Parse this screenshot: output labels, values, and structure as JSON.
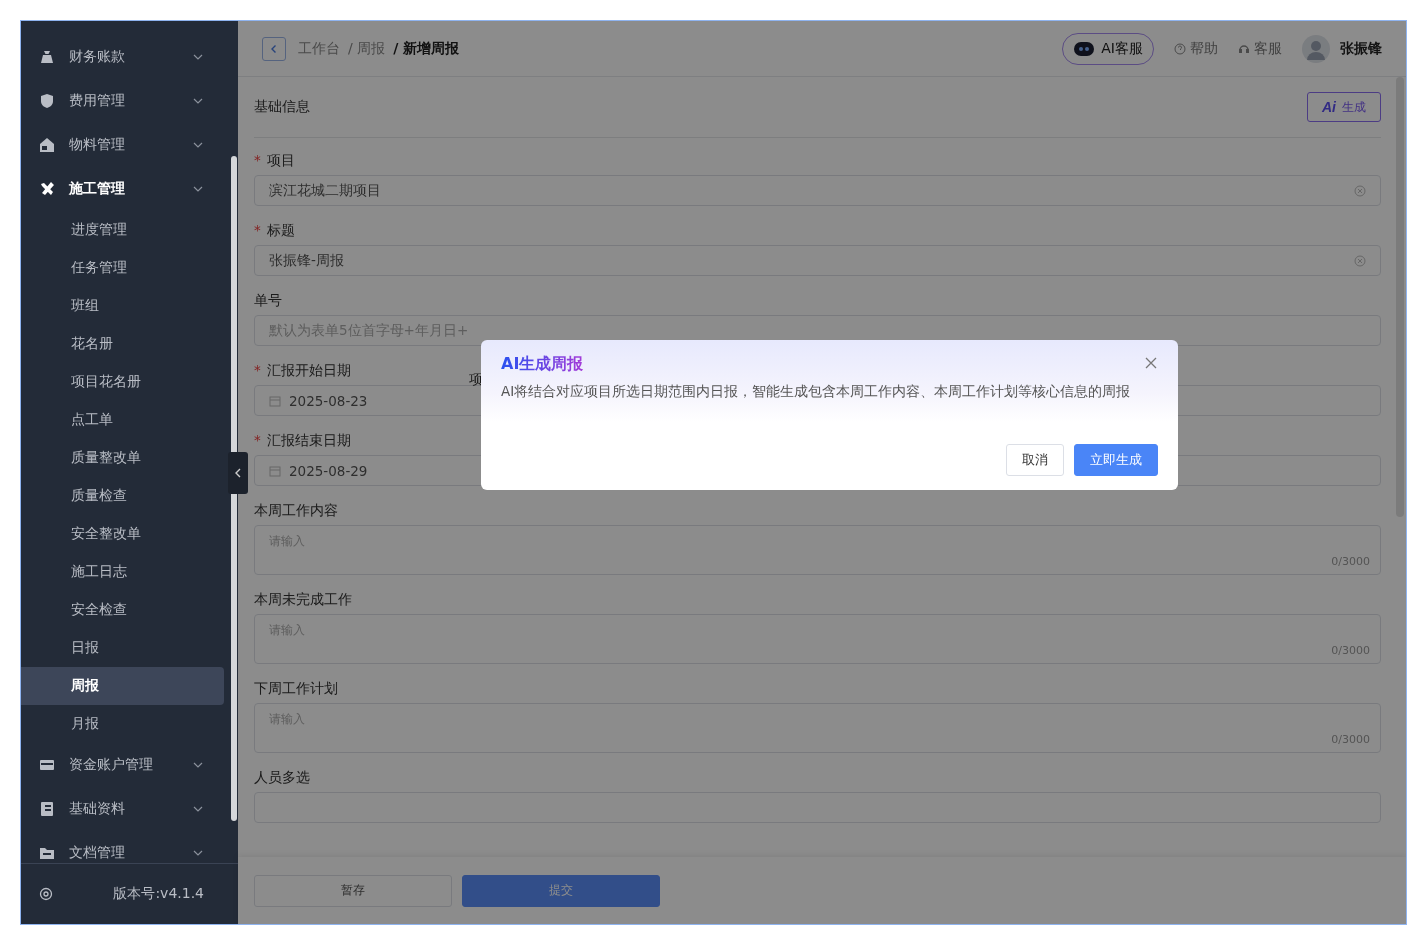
{
  "sidebar": {
    "groups": [
      {
        "label": "财务账款",
        "kind": "money-bag",
        "expanded": false
      },
      {
        "label": "费用管理",
        "kind": "shield",
        "expanded": false
      },
      {
        "label": "物料管理",
        "kind": "house",
        "expanded": false
      },
      {
        "label": "施工管理",
        "kind": "tools",
        "expanded": true,
        "children": [
          {
            "label": "进度管理",
            "selected": false
          },
          {
            "label": "任务管理",
            "selected": false
          },
          {
            "label": "班组",
            "selected": false
          },
          {
            "label": "花名册",
            "selected": false
          },
          {
            "label": "项目花名册",
            "selected": false
          },
          {
            "label": "点工单",
            "selected": false
          },
          {
            "label": "质量整改单",
            "selected": false
          },
          {
            "label": "质量检查",
            "selected": false
          },
          {
            "label": "安全整改单",
            "selected": false
          },
          {
            "label": "施工日志",
            "selected": false
          },
          {
            "label": "安全检查",
            "selected": false
          },
          {
            "label": "日报",
            "selected": false
          },
          {
            "label": "周报",
            "selected": true
          },
          {
            "label": "月报",
            "selected": false
          }
        ]
      },
      {
        "label": "资金账户管理",
        "kind": "card",
        "expanded": false
      },
      {
        "label": "基础资料",
        "kind": "book",
        "expanded": false
      },
      {
        "label": "文档管理",
        "kind": "folder",
        "expanded": false
      }
    ],
    "version": "版本号:v4.1.4"
  },
  "header": {
    "breadcrumb": [
      "工作台",
      "/ 周报",
      "/ 新增周报"
    ],
    "ai_service": "AI客服",
    "help": "帮助",
    "service": "客服",
    "user": "张振锋"
  },
  "form": {
    "section_title": "基础信息",
    "ai_button": {
      "icon_text": "Ai",
      "label": "生成"
    },
    "fields": [
      {
        "kind": "text",
        "label": "项目",
        "required_mark": "*",
        "value": "滨江花城二期项目",
        "clearable": true
      },
      {
        "kind": "text",
        "label": "标题",
        "required_mark": "*",
        "value": "张振锋-周报",
        "clearable": true
      },
      {
        "kind": "text",
        "label": "单号",
        "placeholder": "默认为表单5位首字母+年月日+"
      },
      {
        "kind": "date",
        "label": "汇报开始日期",
        "required_mark": "*",
        "value": "2025-08-23"
      },
      {
        "kind": "date",
        "label": "汇报结束日期",
        "required_mark": "*",
        "value": "2025-08-29"
      },
      {
        "kind": "textarea",
        "label": "本周工作内容",
        "placeholder": "请输入",
        "counter": "0/3000"
      },
      {
        "kind": "textarea",
        "label": "本周未完成工作",
        "placeholder": "请输入",
        "counter": "0/3000"
      },
      {
        "kind": "textarea",
        "label": "下周工作计划",
        "placeholder": "请输入",
        "counter": "0/3000"
      },
      {
        "kind": "multi",
        "label": "人员多选"
      }
    ],
    "hidden_label": "项",
    "buttons": [
      {
        "label": "暂存",
        "kind": "default"
      },
      {
        "label": "提交",
        "kind": "primary"
      }
    ]
  },
  "dialog": {
    "title": "AI生成周报",
    "message": "AI将结合对应项目所选日期范围内日报，智能生成包含本周工作内容、本周工作计划等核心信息的周报",
    "buttons": [
      {
        "label": "取消",
        "kind": "default"
      },
      {
        "label": "立即生成",
        "kind": "primary"
      }
    ]
  }
}
